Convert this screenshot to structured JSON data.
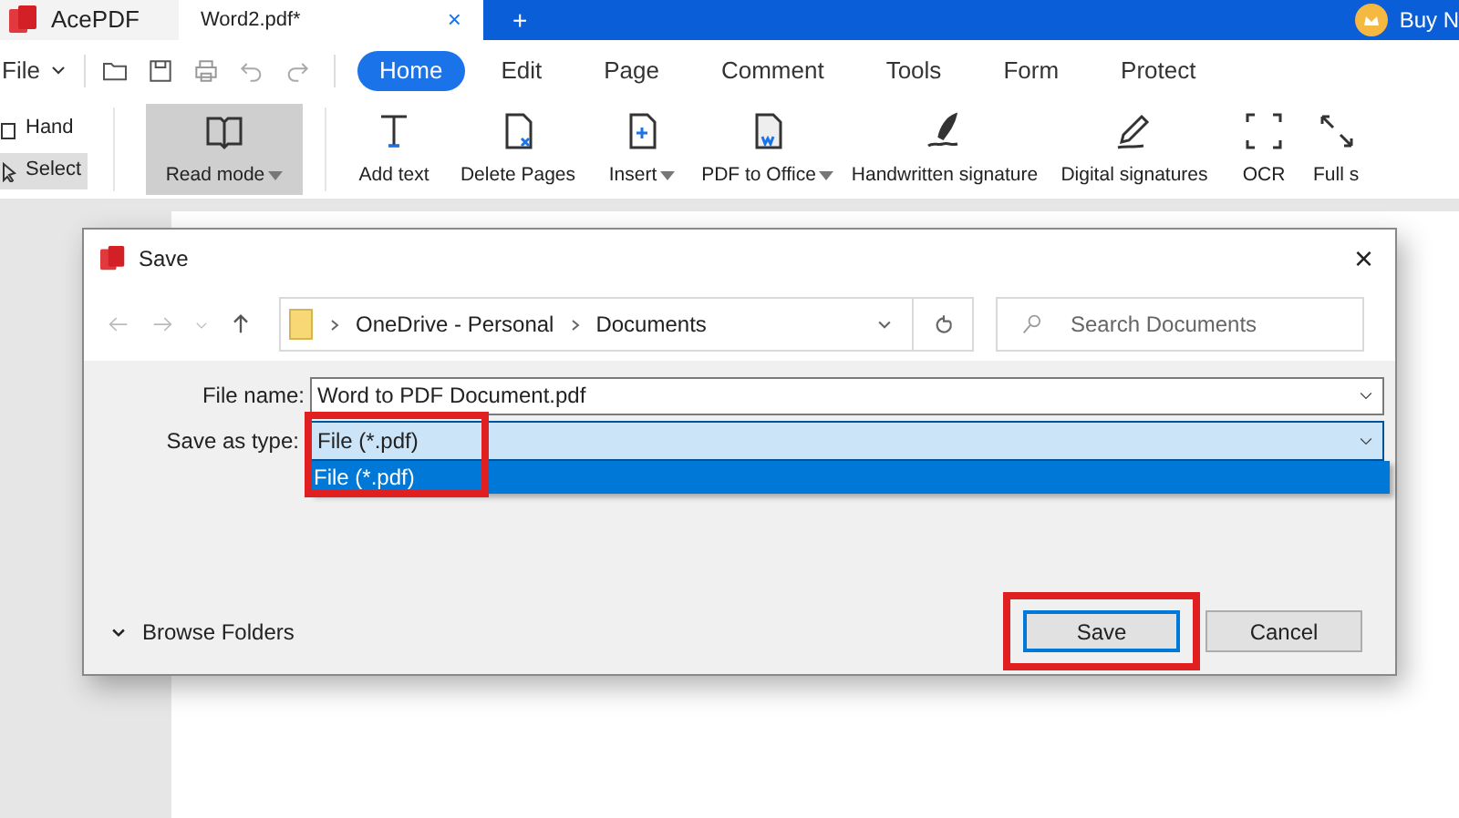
{
  "app": {
    "name": "AcePDF",
    "tabs": [
      {
        "label": "Word2.pdf*",
        "selected": true,
        "close": "×"
      }
    ],
    "new_tab": "+",
    "buy": "Buy N"
  },
  "menu": {
    "file": "File",
    "tabs": [
      {
        "label": "Home",
        "selected": true
      },
      {
        "label": "Edit",
        "selected": false
      },
      {
        "label": "Page",
        "selected": false
      },
      {
        "label": "Comment",
        "selected": false
      },
      {
        "label": "Tools",
        "selected": false
      },
      {
        "label": "Form",
        "selected": false
      },
      {
        "label": "Protect",
        "selected": false
      }
    ]
  },
  "modes": [
    {
      "label": "Hand",
      "selected": false
    },
    {
      "label": "Select",
      "selected": true
    }
  ],
  "toolbar": [
    {
      "label": "Read mode",
      "dropdown": true,
      "selected": true
    },
    {
      "label": "Add text",
      "dropdown": false,
      "selected": false
    },
    {
      "label": "Delete Pages",
      "dropdown": false,
      "selected": false
    },
    {
      "label": "Insert",
      "dropdown": true,
      "selected": false
    },
    {
      "label": "PDF to Office",
      "dropdown": true,
      "selected": false
    },
    {
      "label": "Handwritten signature",
      "dropdown": false,
      "selected": false
    },
    {
      "label": "Digital signatures",
      "dropdown": false,
      "selected": false
    },
    {
      "label": "OCR",
      "dropdown": false,
      "selected": false
    },
    {
      "label": "Full s",
      "dropdown": false,
      "selected": false
    }
  ],
  "dialog": {
    "title": "Save",
    "close": "×",
    "breadcrumbs": [
      "OneDrive - Personal",
      "Documents"
    ],
    "search": {
      "placeholder": "Search Documents"
    },
    "file_name": {
      "label": "File name:",
      "value": "Word to PDF Document.pdf"
    },
    "save_as_type": {
      "label": "Save as type:",
      "value": "File (*.pdf)",
      "highlighted": true,
      "expanded": true,
      "options": [
        {
          "label": "File (*.pdf)",
          "selected": true
        }
      ]
    },
    "browse_folders": {
      "label": "Browse Folders",
      "expanded": false
    },
    "buttons": [
      {
        "label": "Save",
        "default": true,
        "highlighted": true
      },
      {
        "label": "Cancel",
        "default": false,
        "highlighted": false
      }
    ]
  }
}
